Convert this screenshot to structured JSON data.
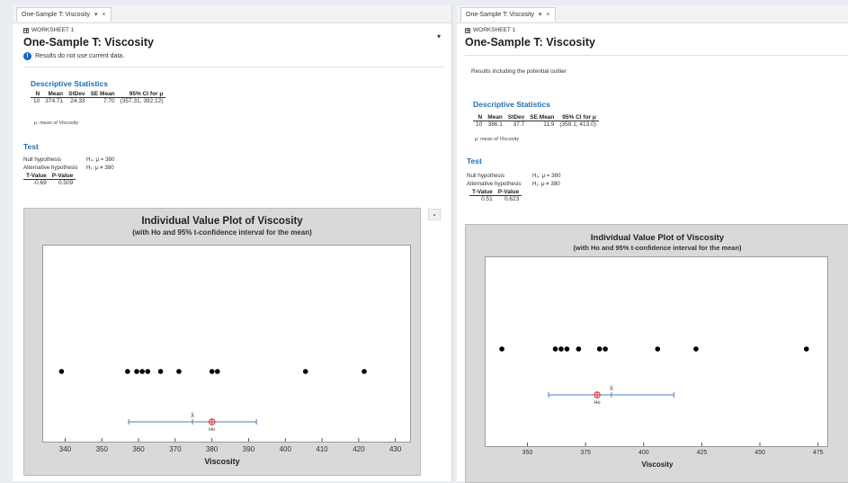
{
  "left": {
    "tab_label": "One-Sample T: Viscosity",
    "worksheet_label": "WORKSHEET 1",
    "title": "One-Sample T: Viscosity",
    "notice": "Results do not use current data.",
    "descriptive": {
      "heading": "Descriptive Statistics",
      "columns": [
        "N",
        "Mean",
        "StDev",
        "SE Mean",
        "95% CI for μ"
      ],
      "row": [
        "10",
        "374.71",
        "24.33",
        "7.70",
        "(357.31, 392.12)"
      ],
      "footnote": "μ: mean of Viscosity"
    },
    "test": {
      "heading": "Test",
      "null_label": "Null hypothesis",
      "null_value": "H₀: μ = 380",
      "alt_label": "Alternative hypothesis",
      "alt_value": "H₁: μ ≠ 380",
      "columns": [
        "T-Value",
        "P-Value"
      ],
      "row": [
        "-0.69",
        "0.509"
      ]
    },
    "chart_data": {
      "type": "scatter",
      "title": "Individual Value Plot of Viscosity",
      "subtitle": "(with Ho and 95% t-confidence interval for the mean)",
      "xlabel": "Viscosity",
      "xlim": [
        334,
        434
      ],
      "xticks": [
        "340",
        "350",
        "360",
        "370",
        "380",
        "390",
        "400",
        "410",
        "420",
        "430"
      ],
      "xtick_values": [
        340,
        350,
        360,
        370,
        380,
        390,
        400,
        410,
        420,
        430
      ],
      "points": [
        339,
        357,
        359.5,
        361,
        362.5,
        366,
        371,
        380,
        381.5,
        405.5,
        421.5
      ],
      "mean": 374.71,
      "ci": [
        357.31,
        392.12
      ],
      "h0": 380,
      "mean_label": "X̄",
      "h0_label": "Ho",
      "ci_color": "#4a7fc1",
      "h0_color": "#d62728"
    }
  },
  "right": {
    "tab_label": "One-Sample T: Viscosity",
    "worksheet_label": "WORKSHEET 1",
    "title": "One-Sample T: Viscosity",
    "note": "Results including the potential outlier",
    "descriptive": {
      "heading": "Descriptive Statistics",
      "columns": [
        "N",
        "Mean",
        "StDev",
        "SE Mean",
        "95% CI for μ"
      ],
      "row": [
        "10",
        "386.1",
        "37.7",
        "11.9",
        "(359.1, 413.0)"
      ],
      "footnote": "μ: mean of Viscosity"
    },
    "test": {
      "heading": "Test",
      "null_label": "Null hypothesis",
      "null_value": "H₀: μ = 380",
      "alt_label": "Alternative hypothesis",
      "alt_value": "H₁: μ ≠ 380",
      "columns": [
        "T-Value",
        "P-Value"
      ],
      "row": [
        "0.51",
        "0.623"
      ]
    },
    "chart_data": {
      "type": "scatter",
      "title": "Individual Value Plot of Viscosity",
      "subtitle": "(with Ho and 95% t-confidence interval for the mean)",
      "xlabel": "Viscosity",
      "xlim": [
        332,
        479
      ],
      "xticks": [
        "350",
        "375",
        "400",
        "425",
        "450",
        "475"
      ],
      "xtick_values": [
        350,
        375,
        400,
        425,
        450,
        475
      ],
      "points": [
        339,
        362,
        364.5,
        367,
        372,
        381,
        383.5,
        406,
        422.5,
        470
      ],
      "mean": 386.1,
      "ci": [
        359.1,
        413.0
      ],
      "h0": 380,
      "mean_label": "X̄",
      "h0_label": "Ho",
      "ci_color": "#4a7fc1",
      "h0_color": "#d62728"
    }
  },
  "icons": {
    "tab_chevron": "▾",
    "tab_close": "×",
    "info": "!",
    "collapse": "⌄"
  }
}
